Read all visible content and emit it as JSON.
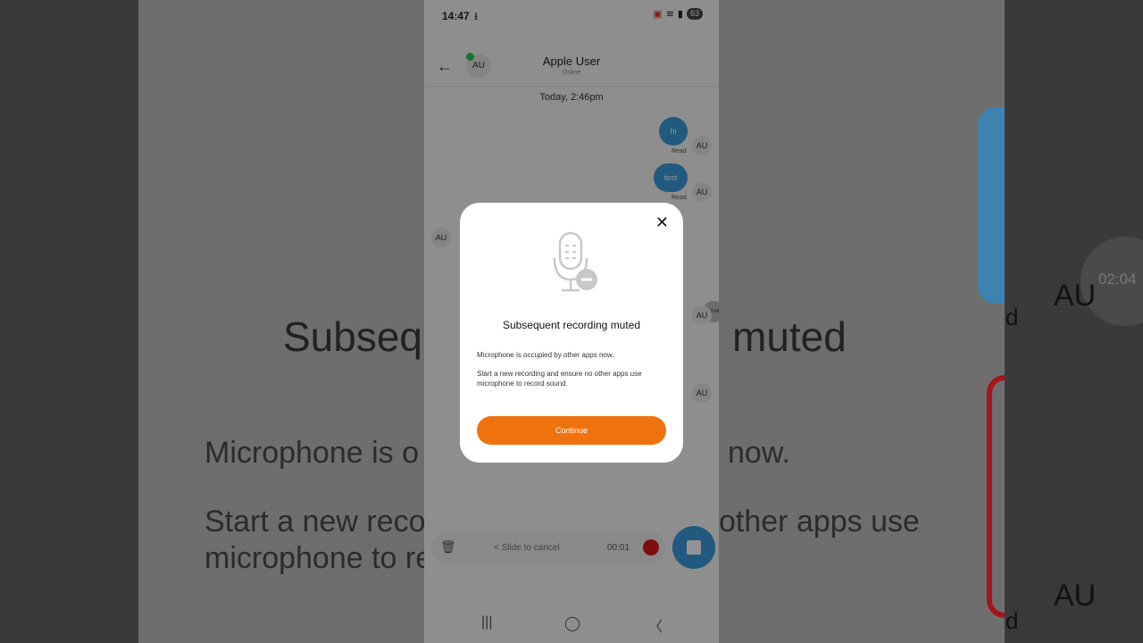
{
  "status_bar": {
    "time": "14:47",
    "download_icon": "download-icon",
    "battery": "63"
  },
  "header": {
    "title": "Apple User",
    "subtitle": "Online",
    "avatar_initials": "AU"
  },
  "chat": {
    "date_separator": "Today, 2:46pm",
    "messages": [
      {
        "text": "hi",
        "receipt": "Read",
        "avatar": "AU"
      },
      {
        "text": "test",
        "receipt": "Read",
        "avatar": "AU"
      }
    ],
    "other_avatar": "AU",
    "extra_avatars": [
      "AU",
      "AU"
    ],
    "audio_time": "02:04"
  },
  "recording_bar": {
    "slide_text": "< Slide to cancel",
    "timer": "00:01"
  },
  "dialog": {
    "title": "Subsequent recording muted",
    "line1": "Microphone is occupied by other apps now.",
    "line2": "Start a new recording and ensure no other apps use microphone to record sound.",
    "button": "Continue"
  },
  "backdrop": {
    "title_left": "Subseq",
    "title_right": "muted",
    "line1_left": "Microphone is o",
    "line1_right": "now.",
    "line2_left": "Start a new reco",
    "line2_right": "other apps use",
    "line3_left": "microphone to re",
    "avatar": "AU",
    "avatar_bottom": "AU",
    "audio_time": "02:04",
    "top_left": "AU",
    "receipt_letter": "d",
    "receipt_letter_bottom": "d"
  },
  "colors": {
    "accent": "#f0720e",
    "bubble": "#3a9bd9",
    "record": "#d61b1b"
  }
}
